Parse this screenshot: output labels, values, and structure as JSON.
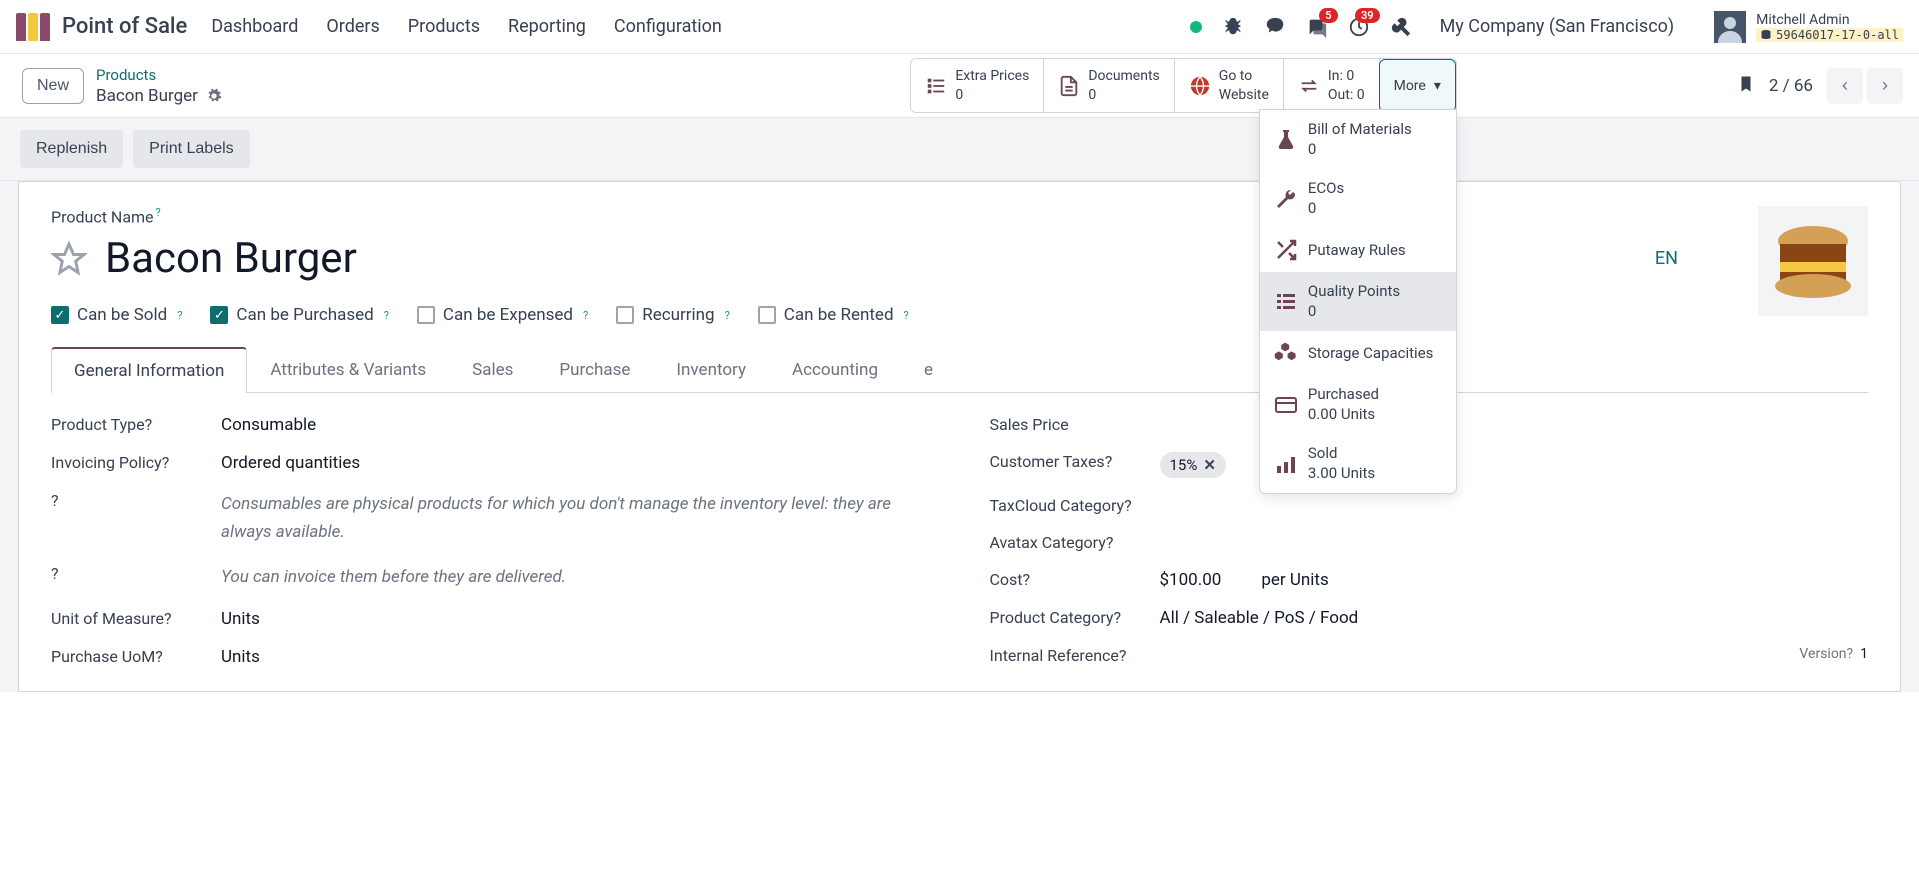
{
  "header": {
    "app_name": "Point of Sale",
    "nav": [
      "Dashboard",
      "Orders",
      "Products",
      "Reporting",
      "Configuration"
    ],
    "badge_messages": "5",
    "badge_activities": "39",
    "company": "My Company (San Francisco)",
    "user_name": "Mitchell Admin",
    "user_db": "59646017-17-0-all"
  },
  "secondbar": {
    "new_label": "New",
    "breadcrumb_link": "Products",
    "breadcrumb_current": "Bacon Burger",
    "stats": {
      "extra_prices": {
        "label": "Extra Prices",
        "value": "0"
      },
      "documents": {
        "label": "Documents",
        "value": "0"
      },
      "website": {
        "line1": "Go to",
        "line2": "Website"
      },
      "inout": {
        "line1": "In: 0",
        "line2": "Out: 0"
      },
      "more": "More"
    },
    "pager": "2 / 66"
  },
  "dropdown": {
    "bom": {
      "label": "Bill of Materials",
      "value": "0"
    },
    "ecos": {
      "label": "ECOs",
      "value": "0"
    },
    "putaway": {
      "label": "Putaway Rules"
    },
    "quality": {
      "label": "Quality Points",
      "value": "0"
    },
    "storage": {
      "label": "Storage Capacities"
    },
    "purchased": {
      "label": "Purchased",
      "value": "0.00 Units"
    },
    "sold": {
      "label": "Sold",
      "value": "3.00 Units"
    }
  },
  "toolbar": {
    "replenish": "Replenish",
    "print_labels": "Print Labels"
  },
  "form": {
    "product_name_label": "Product Name",
    "title": "Bacon Burger",
    "lang": "EN",
    "checks": {
      "sold": "Can be Sold",
      "purchased": "Can be Purchased",
      "expensed": "Can be Expensed",
      "recurring": "Recurring",
      "rented": "Can be Rented"
    },
    "tabs": [
      "General Information",
      "Attributes & Variants",
      "Sales",
      "Purchase",
      "Inventory",
      "Accounting",
      "e"
    ],
    "left": {
      "product_type_label": "Product Type",
      "product_type_value": "Consumable",
      "invoicing_label": "Invoicing Policy",
      "invoicing_value": "Ordered quantities",
      "hint1": "Consumables are physical products for which you don't manage the inventory level: they are always available.",
      "hint2": "You can invoice them before they are delivered.",
      "uom_label": "Unit of Measure",
      "uom_value": "Units",
      "puom_label": "Purchase UoM",
      "puom_value": "Units"
    },
    "right": {
      "sales_price_label": "Sales Price",
      "customer_taxes_label": "Customer Taxes",
      "customer_taxes_value": "15%",
      "taxcloud_label": "TaxCloud Category",
      "avatax_label": "Avatax Category",
      "cost_label": "Cost",
      "cost_value": "$100.00",
      "cost_per": "per Units",
      "category_label": "Product Category",
      "category_value": "All / Saleable / PoS / Food",
      "internal_ref_label": "Internal Reference",
      "version_label": "Version",
      "version_value": "1"
    }
  }
}
